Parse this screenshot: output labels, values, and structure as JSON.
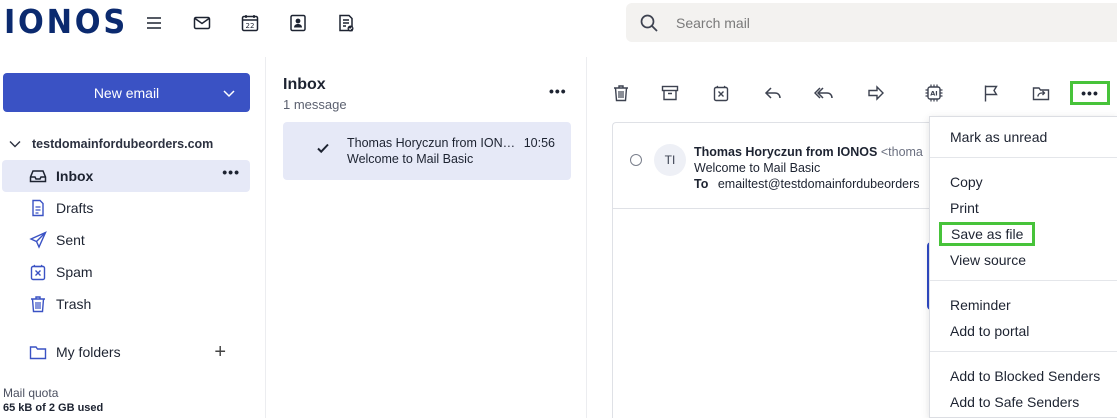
{
  "brand": {
    "logo": "IONOS"
  },
  "search": {
    "placeholder": "Search mail"
  },
  "sidebar": {
    "new_email": "New email",
    "account": "testdomainfordubeorders.com",
    "folders": [
      {
        "label": "Inbox",
        "icon": "inbox-icon"
      },
      {
        "label": "Drafts",
        "icon": "drafts-icon"
      },
      {
        "label": "Sent",
        "icon": "sent-icon"
      },
      {
        "label": "Spam",
        "icon": "spam-icon"
      },
      {
        "label": "Trash",
        "icon": "trash-icon"
      }
    ],
    "inbox_more": "•••",
    "my_folders": "My folders",
    "add": "+",
    "quota_label": "Mail quota",
    "quota_used": "65 kB of 2 GB used"
  },
  "list": {
    "title": "Inbox",
    "count": "1 message",
    "more": "•••",
    "messages": [
      {
        "from": "Thomas Horyczun from IONOS",
        "time": "10:56",
        "subject": "Welcome to Mail Basic"
      }
    ]
  },
  "reading": {
    "from_name": "Thomas Horyczun from IONOS",
    "from_addr": "<thoma",
    "initials": "TI",
    "subject": "Welcome to Mail Basic",
    "to_label": "To",
    "to_addr": "emailtest@testdomainfordubeorders"
  },
  "toolbar": {
    "more": "•••"
  },
  "menu": {
    "mark_unread": "Mark as unread",
    "copy": "Copy",
    "print": "Print",
    "save_as_file": "Save as file",
    "view_source": "View source",
    "reminder": "Reminder",
    "add_to_portal": "Add to portal",
    "add_blocked": "Add to Blocked Senders",
    "add_safe": "Add to Safe Senders"
  },
  "colors": {
    "brand": "#0b2a6f",
    "primary": "#3a52c4",
    "highlight": "#47c33a",
    "selected_bg": "#e6e9f7"
  }
}
